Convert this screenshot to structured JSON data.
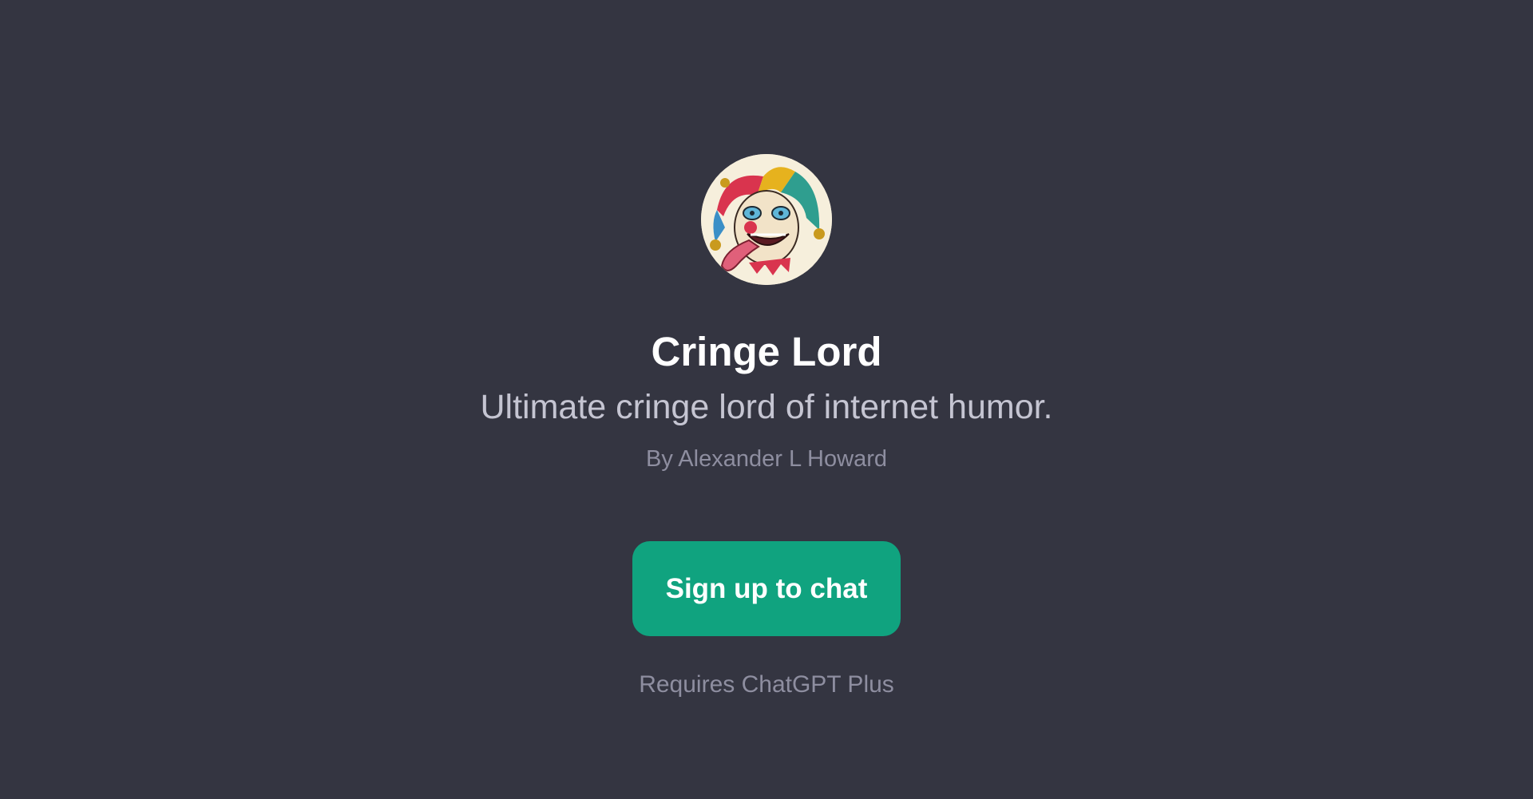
{
  "gpt": {
    "avatar_icon": "jester-clown-avatar",
    "name": "Cringe Lord",
    "description": "Ultimate cringe lord of internet humor.",
    "author": "By Alexander L Howard"
  },
  "actions": {
    "signup_label": "Sign up to chat",
    "requirement": "Requires ChatGPT Plus"
  },
  "colors": {
    "background": "#343541",
    "accent": "#10a37f",
    "title": "#ffffff",
    "subtitle": "#c5c5d2",
    "muted": "#8e8ea0"
  }
}
